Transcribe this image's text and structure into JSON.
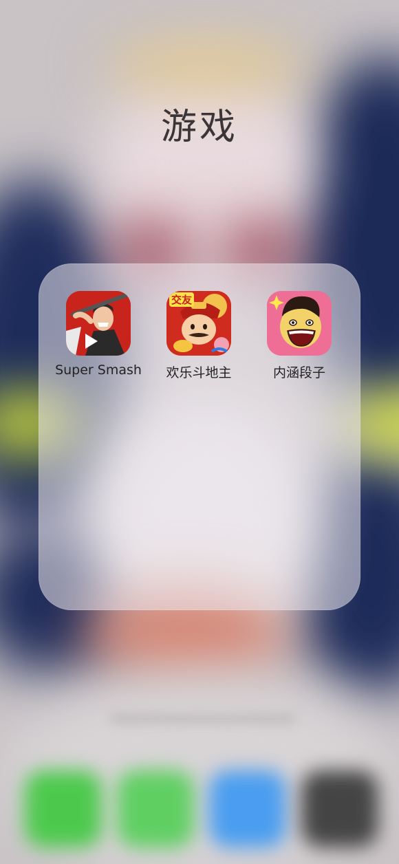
{
  "folder": {
    "title": "游戏"
  },
  "apps": [
    {
      "label": "Super Smash",
      "icon": "super-smash-icon"
    },
    {
      "label": "欢乐斗地主",
      "icon": "doudizhu-icon",
      "badge_text": "交友"
    },
    {
      "label": "内涵段子",
      "icon": "neihan-duanzi-icon"
    }
  ],
  "dock": [
    {
      "icon": "phone-icon",
      "color": "#4cc94c"
    },
    {
      "icon": "messages-icon",
      "color": "#5fcf62"
    },
    {
      "icon": "safari-icon",
      "color": "#4a9df0"
    },
    {
      "icon": "camera-icon",
      "color": "#444444"
    }
  ]
}
